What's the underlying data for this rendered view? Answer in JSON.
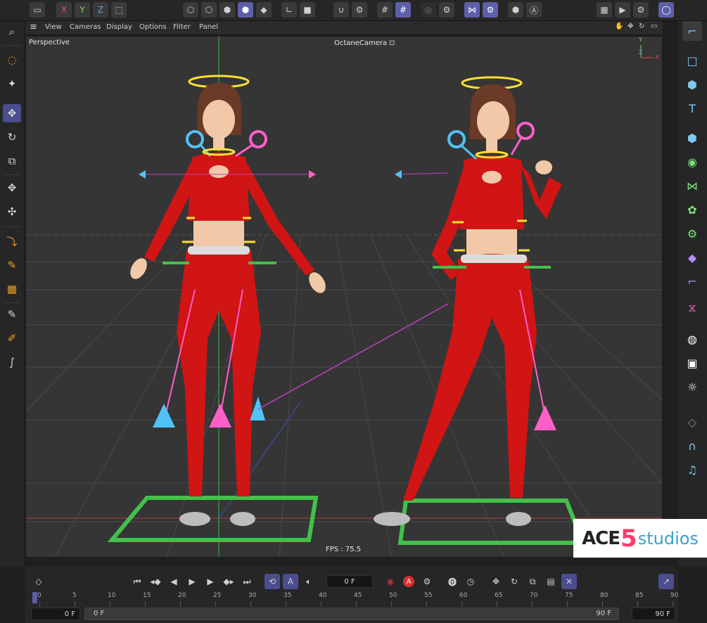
{
  "topbar": {
    "axis_x": "X",
    "axis_y": "Y",
    "axis_z": "Z"
  },
  "menu": {
    "view": "View",
    "cameras": "Cameras",
    "display": "Display",
    "options": "Options",
    "filter": "Filter",
    "panel": "Panel"
  },
  "viewport": {
    "projection": "Perspective",
    "camera": "OctaneCamera",
    "fps": "FPS : 75.5",
    "gizmo_y": "Y",
    "gizmo_z": "Z",
    "gizmo_x": "X"
  },
  "timeline": {
    "current_frame": "0 F",
    "start_field": "0 F",
    "range_start": "0 F",
    "range_end": "90 F",
    "end_field": "90 F",
    "ruler_ticks": [
      "0",
      "5",
      "10",
      "15",
      "20",
      "25",
      "30",
      "35",
      "40",
      "45",
      "50",
      "55",
      "60",
      "65",
      "70",
      "75",
      "80",
      "85",
      "90"
    ]
  },
  "watermark": {
    "ace": "ACE",
    "five": "5",
    "studios": "studios"
  },
  "colors": {
    "accent": "#5d5fa8",
    "suit_red": "#d11414",
    "control_cyan": "#4fc3f7",
    "control_pink": "#ff5fc8",
    "halo_yellow": "#ffe033",
    "base_green": "#43c04a"
  },
  "icons": {
    "camera_icon": "camera-icon",
    "search": "search-icon"
  }
}
